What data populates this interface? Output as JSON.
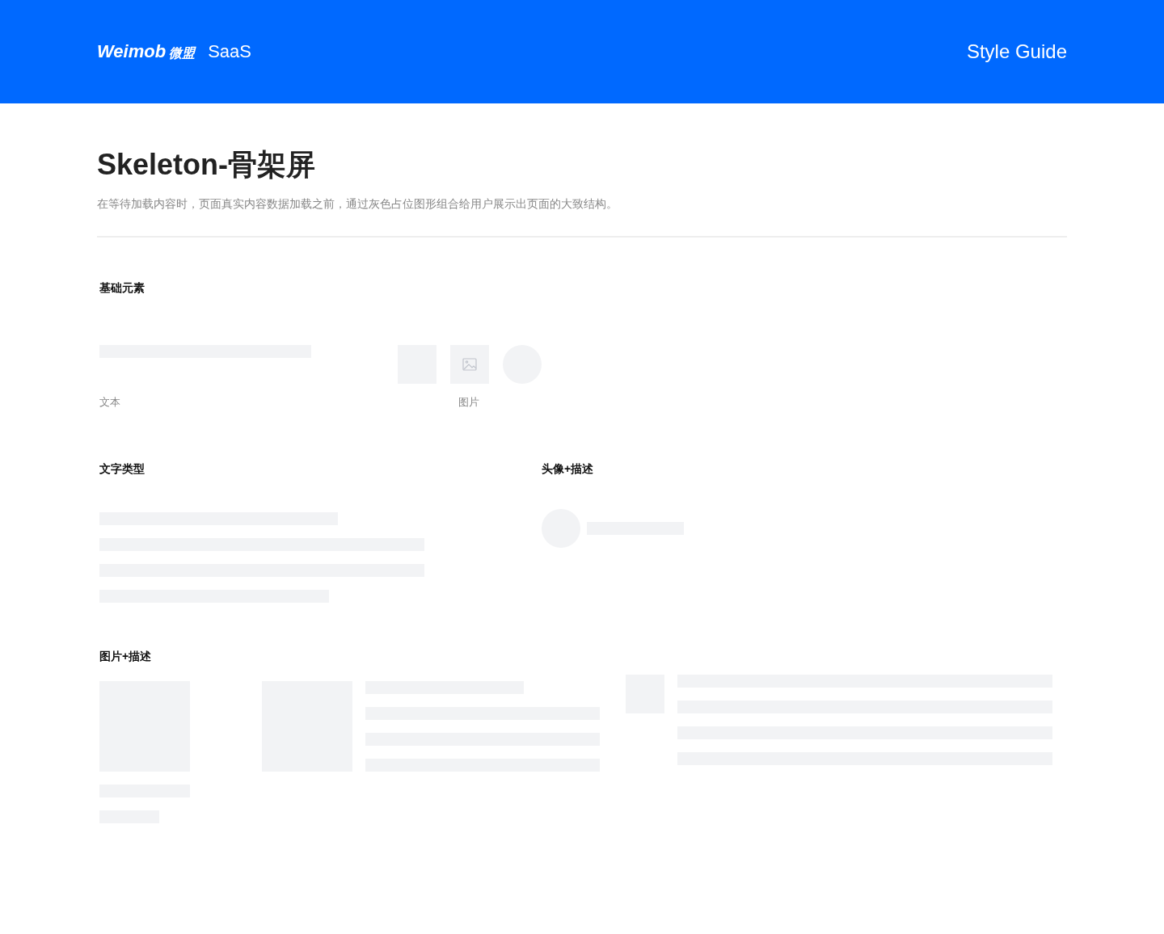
{
  "header": {
    "brand": "Weimob",
    "brand_cn": "微盟",
    "product": "SaaS",
    "link": "Style Guide"
  },
  "page": {
    "title": "Skeleton-骨架屏",
    "description": "在等待加载内容时，页面真实内容数据加载之前，通过灰色占位图形组合给用户展示出页面的大致结构。"
  },
  "basic": {
    "title": "基础元素",
    "text_label": "文本",
    "image_label": "图片"
  },
  "text_type": {
    "title": "文字类型"
  },
  "avatar_desc": {
    "title": "头像+描述"
  },
  "image_desc": {
    "title": "图片+描述"
  }
}
